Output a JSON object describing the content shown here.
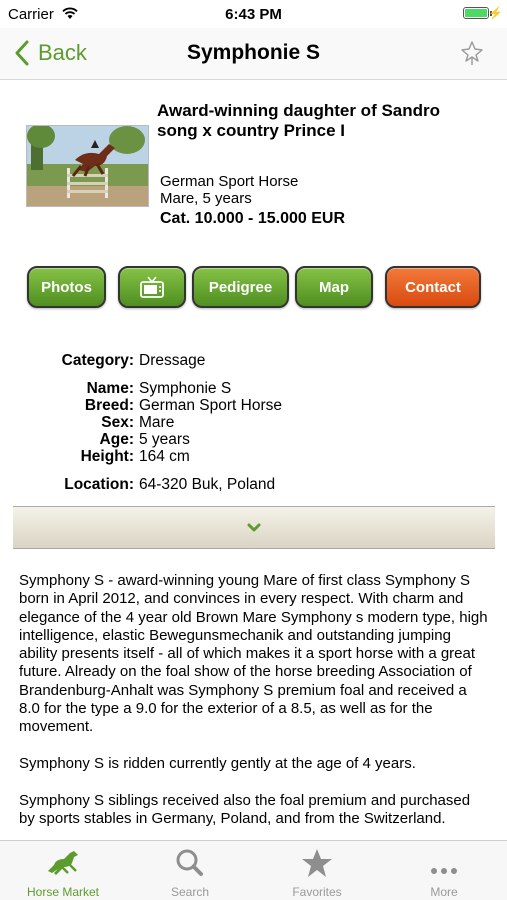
{
  "status": {
    "carrier": "Carrier",
    "time": "6:43 PM"
  },
  "nav": {
    "back_label": "Back",
    "title": "Symphonie S"
  },
  "listing": {
    "headline": "Award-winning daughter of Sandro song x country Prince I",
    "breed": "German Sport Horse",
    "sex_age": "Mare, 5 years",
    "price": "Cat. 10.000 - 15.000 EUR"
  },
  "buttons": {
    "photos": "Photos",
    "video_icon": "tv-icon",
    "pedigree": "Pedigree",
    "map": "Map",
    "contact": "Contact"
  },
  "details": {
    "category": {
      "label": "Category:",
      "value": "Dressage"
    },
    "name": {
      "label": "Name:",
      "value": "Symphonie S"
    },
    "breed": {
      "label": "Breed:",
      "value": "German Sport Horse"
    },
    "sex": {
      "label": "Sex:",
      "value": "Mare"
    },
    "age": {
      "label": "Age:",
      "value": "5 years"
    },
    "height": {
      "label": "Height:",
      "value": "164 cm"
    },
    "location": {
      "label": "Location:",
      "value": "64-320 Buk, Poland"
    }
  },
  "description": {
    "p1": "Symphony S - award-winning young Mare of first class Symphony S born in April 2012, and convinces in every respect.   With charm and elegance of the 4 year old Brown Mare Symphony s modern type, high intelligence, elastic Bewegunsmechanik and outstanding jumping ability presents itself - all of which makes it a sport horse with a great future. Already on the foal show of the horse breeding Association of Brandenburg-Anhalt was Symphony S premium foal and received a 8.0 for the type a 9.0 for the exterior of a 8.5, as well as for the movement.",
    "p2": "Symphony S is ridden currently gently at the age of 4 years.",
    "p3": "Symphony S siblings received also the foal premium and purchased by sports stables in Germany, Poland, and from the Switzerland."
  },
  "tabs": [
    {
      "label": "Horse Market",
      "icon": "horse-icon"
    },
    {
      "label": "Search",
      "icon": "search-icon"
    },
    {
      "label": "Favorites",
      "icon": "star-icon"
    },
    {
      "label": "More",
      "icon": "more-icon"
    }
  ],
  "colors": {
    "accent": "#5c9c2e",
    "button_green": "#5fa02e",
    "button_orange": "#e65c1e",
    "tab_inactive": "#999999"
  }
}
